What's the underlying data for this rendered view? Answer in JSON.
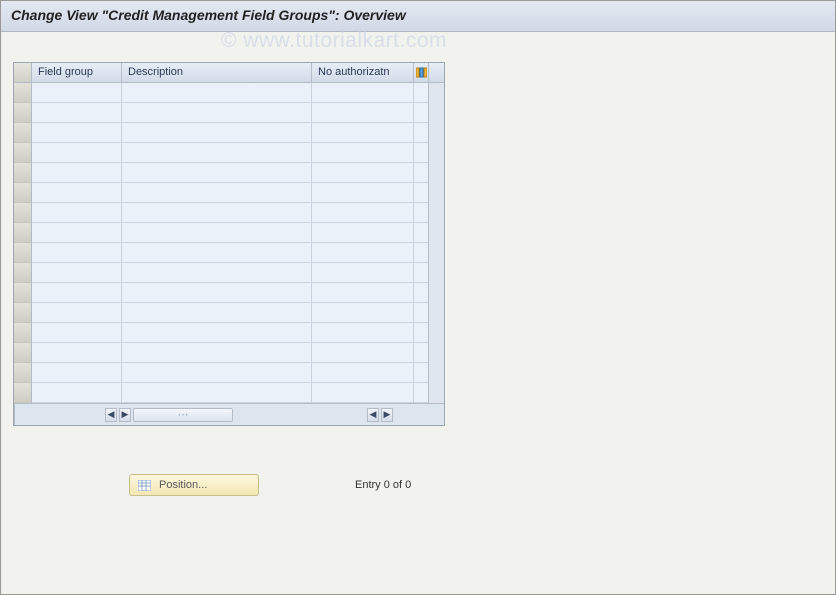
{
  "title": "Change View \"Credit Management Field Groups\": Overview",
  "watermark": "© www.tutorialkart.com",
  "columns": {
    "field_group": "Field group",
    "description": "Description",
    "no_auth": "No authorizatn"
  },
  "rows": [
    {
      "field_group": "",
      "description": "",
      "no_auth": ""
    },
    {
      "field_group": "",
      "description": "",
      "no_auth": ""
    },
    {
      "field_group": "",
      "description": "",
      "no_auth": ""
    },
    {
      "field_group": "",
      "description": "",
      "no_auth": ""
    },
    {
      "field_group": "",
      "description": "",
      "no_auth": ""
    },
    {
      "field_group": "",
      "description": "",
      "no_auth": ""
    },
    {
      "field_group": "",
      "description": "",
      "no_auth": ""
    },
    {
      "field_group": "",
      "description": "",
      "no_auth": ""
    },
    {
      "field_group": "",
      "description": "",
      "no_auth": ""
    },
    {
      "field_group": "",
      "description": "",
      "no_auth": ""
    },
    {
      "field_group": "",
      "description": "",
      "no_auth": ""
    },
    {
      "field_group": "",
      "description": "",
      "no_auth": ""
    },
    {
      "field_group": "",
      "description": "",
      "no_auth": ""
    },
    {
      "field_group": "",
      "description": "",
      "no_auth": ""
    },
    {
      "field_group": "",
      "description": "",
      "no_auth": ""
    },
    {
      "field_group": "",
      "description": "",
      "no_auth": ""
    }
  ],
  "position_button_label": "Position...",
  "status": "Entry 0 of 0",
  "icons": {
    "settings": "columns-icon",
    "position": "table-icon"
  }
}
